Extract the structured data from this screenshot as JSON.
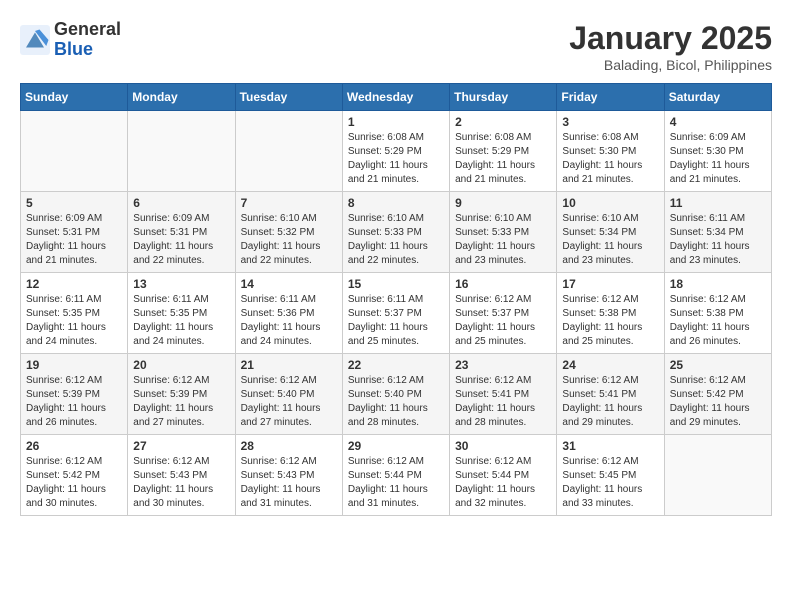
{
  "header": {
    "logo_line1": "General",
    "logo_line2": "Blue",
    "month": "January 2025",
    "location": "Balading, Bicol, Philippines"
  },
  "days_of_week": [
    "Sunday",
    "Monday",
    "Tuesday",
    "Wednesday",
    "Thursday",
    "Friday",
    "Saturday"
  ],
  "weeks": [
    [
      {
        "day": "",
        "info": ""
      },
      {
        "day": "",
        "info": ""
      },
      {
        "day": "",
        "info": ""
      },
      {
        "day": "1",
        "info": "Sunrise: 6:08 AM\nSunset: 5:29 PM\nDaylight: 11 hours\nand 21 minutes."
      },
      {
        "day": "2",
        "info": "Sunrise: 6:08 AM\nSunset: 5:29 PM\nDaylight: 11 hours\nand 21 minutes."
      },
      {
        "day": "3",
        "info": "Sunrise: 6:08 AM\nSunset: 5:30 PM\nDaylight: 11 hours\nand 21 minutes."
      },
      {
        "day": "4",
        "info": "Sunrise: 6:09 AM\nSunset: 5:30 PM\nDaylight: 11 hours\nand 21 minutes."
      }
    ],
    [
      {
        "day": "5",
        "info": "Sunrise: 6:09 AM\nSunset: 5:31 PM\nDaylight: 11 hours\nand 21 minutes."
      },
      {
        "day": "6",
        "info": "Sunrise: 6:09 AM\nSunset: 5:31 PM\nDaylight: 11 hours\nand 22 minutes."
      },
      {
        "day": "7",
        "info": "Sunrise: 6:10 AM\nSunset: 5:32 PM\nDaylight: 11 hours\nand 22 minutes."
      },
      {
        "day": "8",
        "info": "Sunrise: 6:10 AM\nSunset: 5:33 PM\nDaylight: 11 hours\nand 22 minutes."
      },
      {
        "day": "9",
        "info": "Sunrise: 6:10 AM\nSunset: 5:33 PM\nDaylight: 11 hours\nand 23 minutes."
      },
      {
        "day": "10",
        "info": "Sunrise: 6:10 AM\nSunset: 5:34 PM\nDaylight: 11 hours\nand 23 minutes."
      },
      {
        "day": "11",
        "info": "Sunrise: 6:11 AM\nSunset: 5:34 PM\nDaylight: 11 hours\nand 23 minutes."
      }
    ],
    [
      {
        "day": "12",
        "info": "Sunrise: 6:11 AM\nSunset: 5:35 PM\nDaylight: 11 hours\nand 24 minutes."
      },
      {
        "day": "13",
        "info": "Sunrise: 6:11 AM\nSunset: 5:35 PM\nDaylight: 11 hours\nand 24 minutes."
      },
      {
        "day": "14",
        "info": "Sunrise: 6:11 AM\nSunset: 5:36 PM\nDaylight: 11 hours\nand 24 minutes."
      },
      {
        "day": "15",
        "info": "Sunrise: 6:11 AM\nSunset: 5:37 PM\nDaylight: 11 hours\nand 25 minutes."
      },
      {
        "day": "16",
        "info": "Sunrise: 6:12 AM\nSunset: 5:37 PM\nDaylight: 11 hours\nand 25 minutes."
      },
      {
        "day": "17",
        "info": "Sunrise: 6:12 AM\nSunset: 5:38 PM\nDaylight: 11 hours\nand 25 minutes."
      },
      {
        "day": "18",
        "info": "Sunrise: 6:12 AM\nSunset: 5:38 PM\nDaylight: 11 hours\nand 26 minutes."
      }
    ],
    [
      {
        "day": "19",
        "info": "Sunrise: 6:12 AM\nSunset: 5:39 PM\nDaylight: 11 hours\nand 26 minutes."
      },
      {
        "day": "20",
        "info": "Sunrise: 6:12 AM\nSunset: 5:39 PM\nDaylight: 11 hours\nand 27 minutes."
      },
      {
        "day": "21",
        "info": "Sunrise: 6:12 AM\nSunset: 5:40 PM\nDaylight: 11 hours\nand 27 minutes."
      },
      {
        "day": "22",
        "info": "Sunrise: 6:12 AM\nSunset: 5:40 PM\nDaylight: 11 hours\nand 28 minutes."
      },
      {
        "day": "23",
        "info": "Sunrise: 6:12 AM\nSunset: 5:41 PM\nDaylight: 11 hours\nand 28 minutes."
      },
      {
        "day": "24",
        "info": "Sunrise: 6:12 AM\nSunset: 5:41 PM\nDaylight: 11 hours\nand 29 minutes."
      },
      {
        "day": "25",
        "info": "Sunrise: 6:12 AM\nSunset: 5:42 PM\nDaylight: 11 hours\nand 29 minutes."
      }
    ],
    [
      {
        "day": "26",
        "info": "Sunrise: 6:12 AM\nSunset: 5:42 PM\nDaylight: 11 hours\nand 30 minutes."
      },
      {
        "day": "27",
        "info": "Sunrise: 6:12 AM\nSunset: 5:43 PM\nDaylight: 11 hours\nand 30 minutes."
      },
      {
        "day": "28",
        "info": "Sunrise: 6:12 AM\nSunset: 5:43 PM\nDaylight: 11 hours\nand 31 minutes."
      },
      {
        "day": "29",
        "info": "Sunrise: 6:12 AM\nSunset: 5:44 PM\nDaylight: 11 hours\nand 31 minutes."
      },
      {
        "day": "30",
        "info": "Sunrise: 6:12 AM\nSunset: 5:44 PM\nDaylight: 11 hours\nand 32 minutes."
      },
      {
        "day": "31",
        "info": "Sunrise: 6:12 AM\nSunset: 5:45 PM\nDaylight: 11 hours\nand 33 minutes."
      },
      {
        "day": "",
        "info": ""
      }
    ]
  ]
}
